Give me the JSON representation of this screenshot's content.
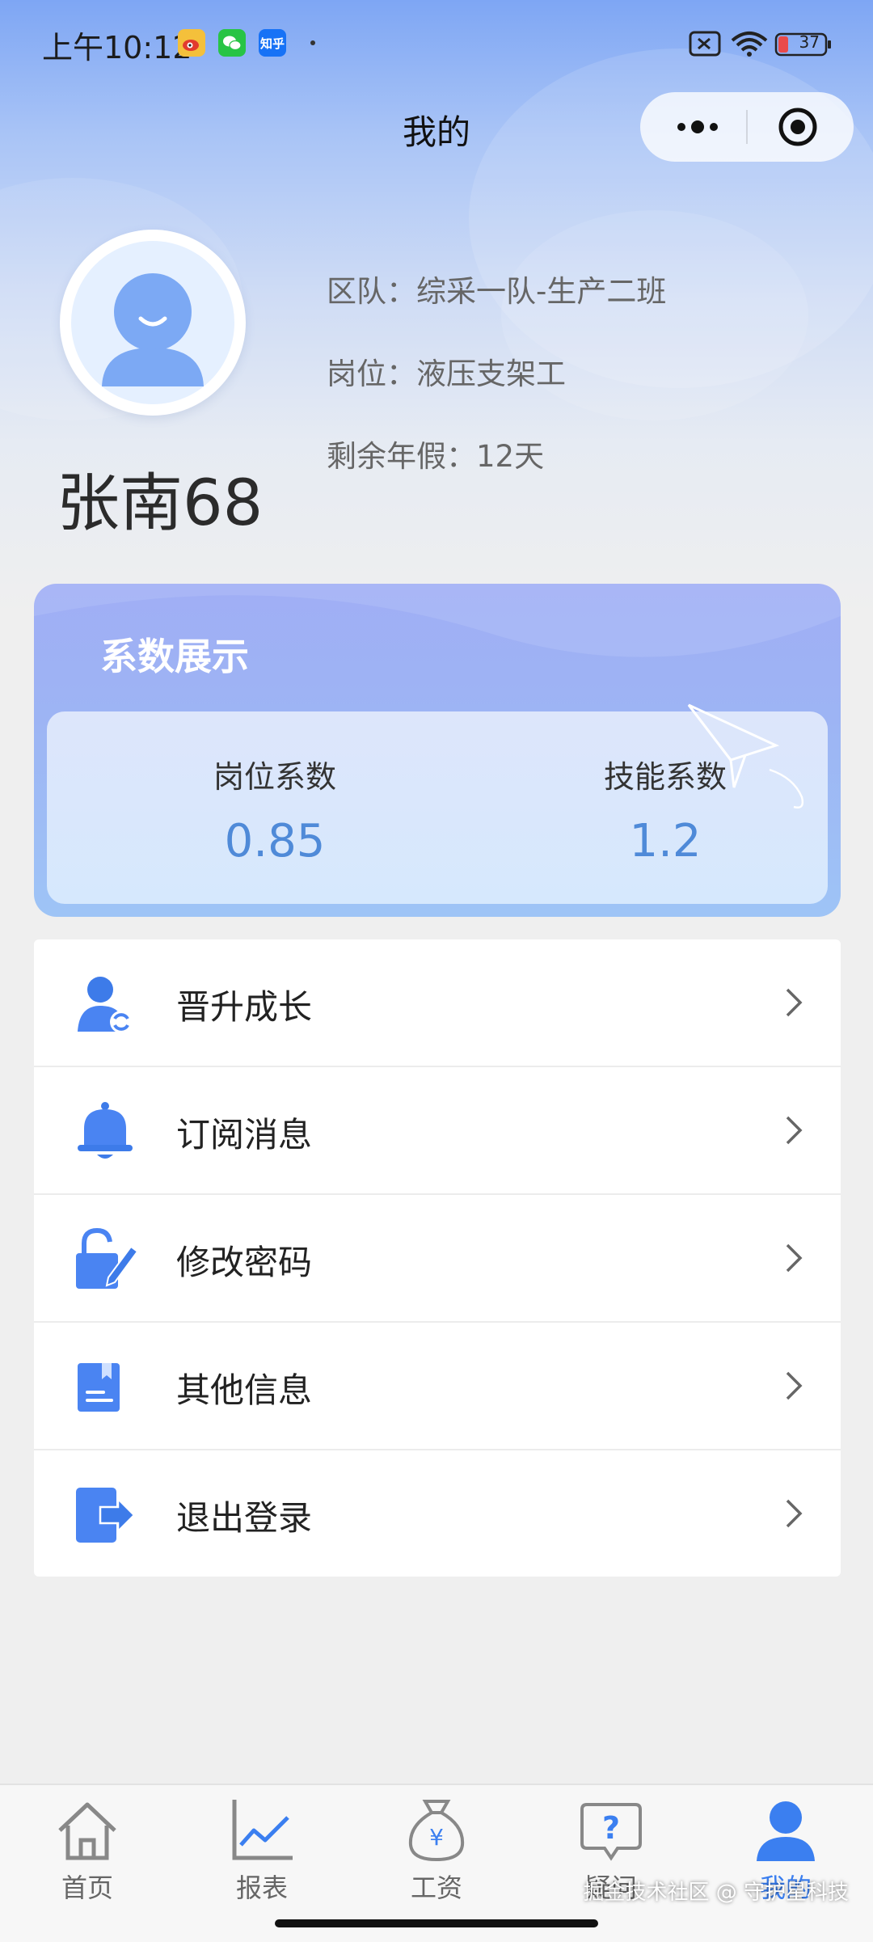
{
  "status_bar": {
    "time": "上午10:12",
    "app_icons": [
      "weibo-icon",
      "wechat-icon",
      "zhihu-icon"
    ],
    "zhihu_text": "知乎",
    "battery": "37"
  },
  "nav": {
    "title": "我的",
    "more_icon": "more-dots-icon",
    "close_icon": "target-icon"
  },
  "profile": {
    "name": "张南68",
    "team": "区队：综采一队-生产二班",
    "post": "岗位：液压支架工",
    "leave": "剩余年假：12天"
  },
  "coefficients": {
    "title": "系数展示",
    "items": [
      {
        "label": "岗位系数",
        "value": "0.85"
      },
      {
        "label": "技能系数",
        "value": "1.2"
      }
    ]
  },
  "menu": {
    "items": [
      {
        "label": "晋升成长",
        "icon": "user-growth-icon"
      },
      {
        "label": "订阅消息",
        "icon": "bell-icon"
      },
      {
        "label": "修改密码",
        "icon": "unlock-edit-icon"
      },
      {
        "label": "其他信息",
        "icon": "document-icon"
      },
      {
        "label": "退出登录",
        "icon": "logout-icon"
      }
    ]
  },
  "tabbar": {
    "tabs": [
      {
        "label": "首页",
        "icon": "home-icon"
      },
      {
        "label": "报表",
        "icon": "chart-icon"
      },
      {
        "label": "工资",
        "icon": "money-bag-icon"
      },
      {
        "label": "疑问",
        "icon": "question-icon"
      },
      {
        "label": "我的",
        "icon": "user-icon"
      }
    ],
    "active": "我的"
  },
  "watermark": "掘金技术社区 @ 守护星科技",
  "colors": {
    "accent": "#3b7ff0",
    "coef_value": "#4f8ad8",
    "icon_blue": "#4a84f2"
  }
}
